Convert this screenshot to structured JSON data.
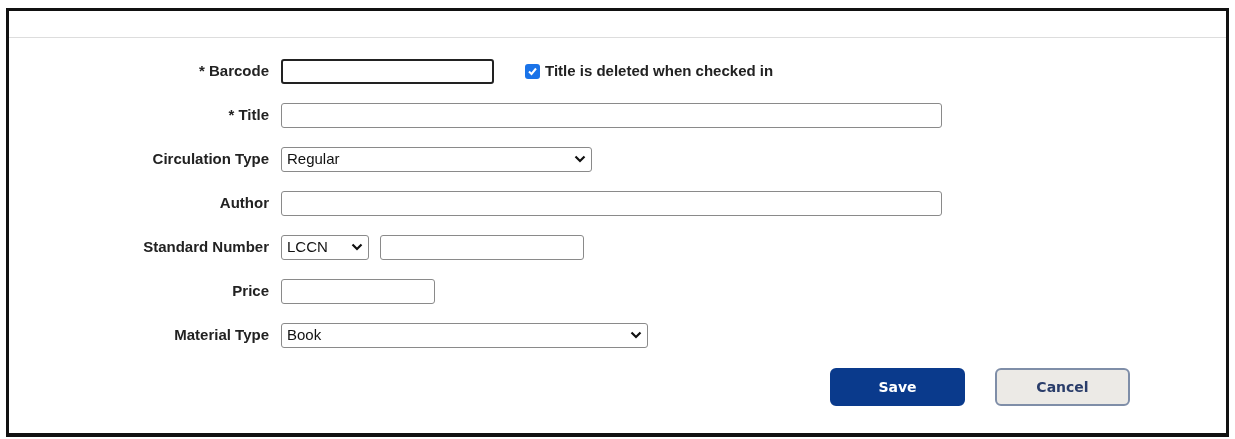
{
  "form": {
    "fields": [
      {
        "label": "* Barcode",
        "kind": "text",
        "focused": true,
        "checkbox": {
          "label": "Title is deleted when checked in",
          "checked": true
        }
      },
      {
        "label": "* Title",
        "kind": "text",
        "focused": false
      },
      {
        "label": "Circulation Type",
        "kind": "select",
        "value": "Regular"
      },
      {
        "label": "Author",
        "kind": "text",
        "focused": false
      },
      {
        "label": "Standard Number",
        "kind": "select_text",
        "value": "LCCN"
      },
      {
        "label": "Price",
        "kind": "text",
        "focused": false
      },
      {
        "label": "Material Type",
        "kind": "select",
        "value": "Book"
      }
    ]
  },
  "buttons": [
    {
      "label": "Save",
      "kind": "primary"
    },
    {
      "label": "Cancel",
      "kind": "secondary"
    }
  ]
}
